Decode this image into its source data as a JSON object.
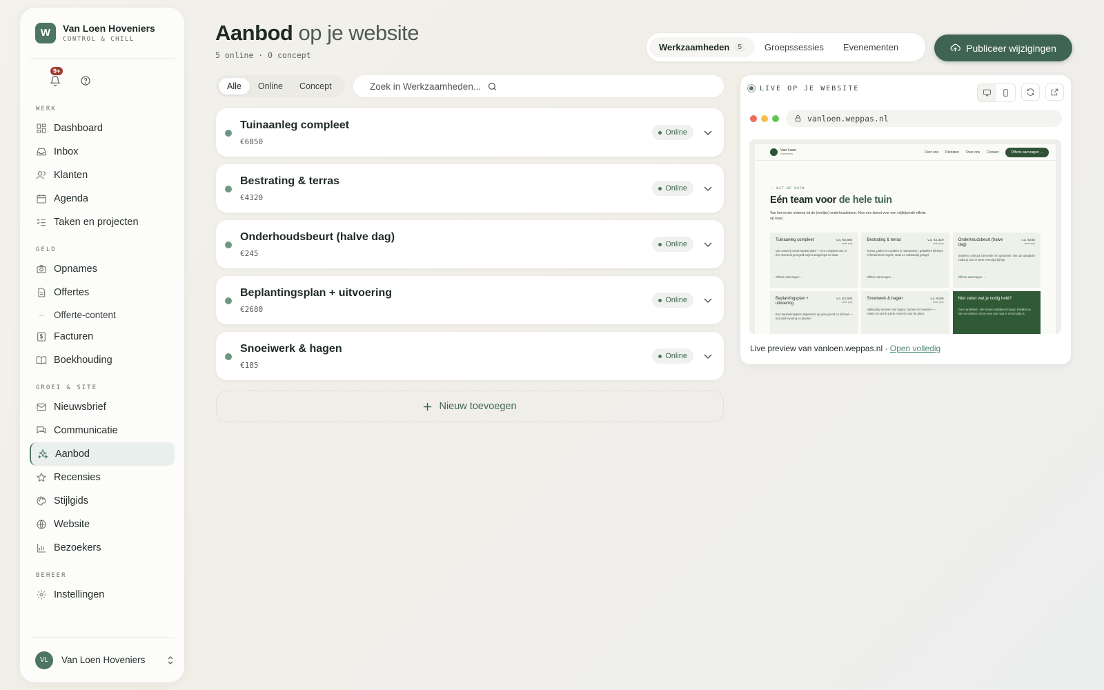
{
  "brand": {
    "logo_letter": "W",
    "name": "Van Loen Hoveniers",
    "tagline": "CONTROL & CHILL"
  },
  "notifications": {
    "badge": "9+"
  },
  "sidebar": {
    "sections": [
      {
        "label": "WERK",
        "items": [
          {
            "label": "Dashboard",
            "icon": "grid-icon"
          },
          {
            "label": "Inbox",
            "icon": "inbox-icon"
          },
          {
            "label": "Klanten",
            "icon": "users-icon"
          },
          {
            "label": "Agenda",
            "icon": "calendar-icon"
          },
          {
            "label": "Taken en projecten",
            "icon": "checklist-icon"
          }
        ]
      },
      {
        "label": "GELD",
        "items": [
          {
            "label": "Opnames",
            "icon": "camera-icon"
          },
          {
            "label": "Offertes",
            "icon": "document-icon"
          },
          {
            "label": "Offerte-content",
            "icon": "dash"
          },
          {
            "label": "Facturen",
            "icon": "dollar-icon"
          },
          {
            "label": "Boekhouding",
            "icon": "book-icon"
          }
        ]
      },
      {
        "label": "GROEI & SITE",
        "items": [
          {
            "label": "Nieuwsbrief",
            "icon": "mail-icon"
          },
          {
            "label": "Communicatie",
            "icon": "chat-icon"
          },
          {
            "label": "Aanbod",
            "icon": "sparkles-icon",
            "active": true
          },
          {
            "label": "Recensies",
            "icon": "star-icon"
          },
          {
            "label": "Stijlgids",
            "icon": "palette-icon"
          },
          {
            "label": "Website",
            "icon": "globe-icon"
          },
          {
            "label": "Bezoekers",
            "icon": "bar-chart-icon"
          }
        ]
      },
      {
        "label": "BEHEER",
        "items": [
          {
            "label": "Instellingen",
            "icon": "gear-icon"
          }
        ]
      }
    ],
    "user": {
      "initials": "VL",
      "name": "Van Loen Hoveniers"
    }
  },
  "header": {
    "title_bold": "Aanbod",
    "title_rest": " op je website",
    "subtitle": "5 online · 0 concept",
    "tabs": [
      {
        "label": "Werkzaamheden",
        "count": "5",
        "active": true
      },
      {
        "label": "Groepssessies"
      },
      {
        "label": "Evenementen"
      }
    ],
    "publish_label": "Publiceer wijzigingen"
  },
  "filters": {
    "options": [
      "Alle",
      "Online",
      "Concept"
    ],
    "active": "Alle"
  },
  "search": {
    "placeholder": "Zoek in Werkzaamheden..."
  },
  "services": [
    {
      "title": "Tuinaanleg compleet",
      "price": "€6850",
      "status": "Online"
    },
    {
      "title": "Bestrating & terras",
      "price": "€4320",
      "status": "Online"
    },
    {
      "title": "Onderhoudsbeurt (halve dag)",
      "price": "€245",
      "status": "Online"
    },
    {
      "title": "Beplantingsplan + uitvoering",
      "price": "€2680",
      "status": "Online"
    },
    {
      "title": "Snoeiwerk & hagen",
      "price": "€185",
      "status": "Online"
    }
  ],
  "add_new_label": "Nieuw toevoegen",
  "preview": {
    "label": "LIVE OP JE WEBSITE",
    "url": "vanloen.weppas.nl",
    "caption": "Live preview van vanloen.weppas.nl · ",
    "open_link": "Open volledig",
    "site": {
      "brand": "Van Loen",
      "brand_sub": "Hoveniers",
      "nav": [
        "Over ons",
        "Diensten",
        "Over ons",
        "Contact"
      ],
      "cta": "Offerte aanvragen →",
      "eyebrow": "— WAT WE DOEN",
      "hero_plain": "Eén team voor ",
      "hero_accent": "de hele tuin",
      "hero_text": "Van het eerste ontwerp tot de (eerlijke) onderhoudsbeurt. Kies een dienst voor een vrijblijvende offerte op maat.",
      "cards": [
        {
          "title": "Tuinaanleg compleet",
          "price": "v.a. €6.850",
          "unit": "vaste prijs",
          "text": "Van ontwerp tot de laatste plant — een complete tuin, in één vloeiend geregeld traject aangelegd en klaar.",
          "link": "Offerte aanvragen →"
        },
        {
          "title": "Bestrating & terras",
          "price": "v.a. €4.320",
          "unit": "vaste prijs",
          "text": "Terras, paden en opritten in natuursteen, gebakken klinkers of keramische tegels, strak en vakkundig gelegd.",
          "link": "Offerte aanvragen →"
        },
        {
          "title": "Onderhoudsbeurt (halve dag)",
          "price": "v.a. €245",
          "unit": "vaste prijs",
          "text": "Snoeien, onkruid, bemesten en opruimen: vier uur aandacht zodat je tuin er weer verzorgd bij ligt.",
          "link": "Offerte aanvragen →"
        },
        {
          "title": "Beplantingsplan + uitvoering",
          "price": "v.a. €2.680",
          "unit": "vaste prijs",
          "text": "Een beplantingsplan afgestemd op jouw grond en lichtval — inclusief levering en planten.",
          "link": ""
        },
        {
          "title": "Snoeiwerk & hagen",
          "price": "v.a. €185",
          "unit": "vaste prijs",
          "text": "Vakkundig snoeien van hagen, bomen en heesters — netjes en op het juiste moment voor de plant.",
          "link": ""
        },
        {
          "title": "Niet zeker wat je nodig hebt?",
          "price": "",
          "unit": "",
          "text": "Geen probleem. We komen vrijblijvend langs, bekijken je tuin en denken met je mee over wat er echt nodig is.",
          "link": "",
          "highlight": true
        }
      ]
    }
  }
}
